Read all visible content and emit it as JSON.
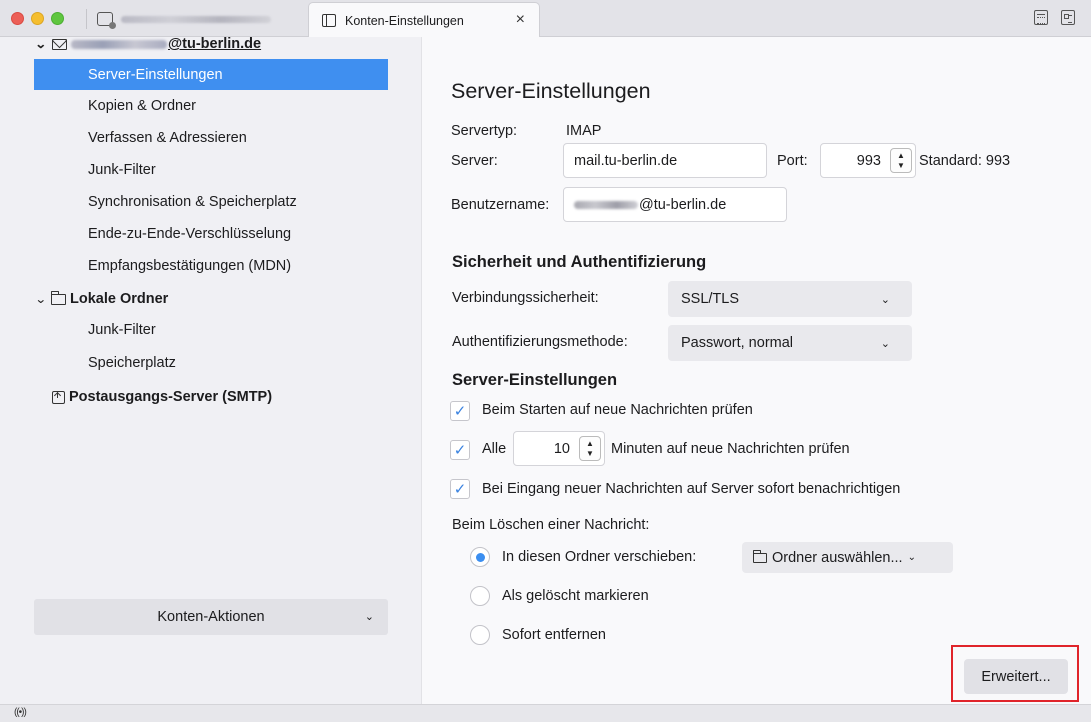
{
  "tabs": {
    "active_title": "Konten-Einstellungen",
    "close_glyph": "×"
  },
  "sidebar": {
    "account_domain": "@tu-berlin.de",
    "account_items": [
      {
        "label": "Server-Einstellungen",
        "selected": true
      },
      {
        "label": "Kopien & Ordner"
      },
      {
        "label": "Verfassen & Adressieren"
      },
      {
        "label": "Junk-Filter"
      },
      {
        "label": "Synchronisation & Speicherplatz"
      },
      {
        "label": "Ende-zu-Ende-Verschlüsselung"
      },
      {
        "label": "Empfangsbestätigungen (MDN)"
      }
    ],
    "local_folders_label": "Lokale Ordner",
    "local_items": [
      {
        "label": "Junk-Filter"
      },
      {
        "label": "Speicherplatz"
      }
    ],
    "smtp_label": "Postausgangs-Server (SMTP)",
    "account_actions_label": "Konten-Aktionen"
  },
  "main": {
    "title": "Server-Einstellungen",
    "servertype_label": "Servertyp:",
    "servertype_value": "IMAP",
    "server_label": "Server:",
    "server_value": "mail.tu-berlin.de",
    "port_label": "Port:",
    "port_value": "993",
    "standard_label": "Standard: 993",
    "username_label": "Benutzername:",
    "username_domain": "@tu-berlin.de",
    "security_heading": "Sicherheit und Authentifizierung",
    "connection_security_label": "Verbindungssicherheit:",
    "connection_security_value": "SSL/TLS",
    "auth_method_label": "Authentifizierungsmethode:",
    "auth_method_value": "Passwort, normal",
    "server_settings_heading": "Server-Einstellungen",
    "check_on_start_label": "Beim Starten auf neue Nachrichten prüfen",
    "check_on_start_checked": true,
    "check_every_label": "Alle",
    "check_every_value": "10",
    "check_every_suffix": "Minuten auf neue Nachrichten prüfen",
    "check_every_checked": true,
    "notify_label": "Bei Eingang neuer Nachrichten auf Server sofort benachrichtigen",
    "notify_checked": true,
    "delete_heading": "Beim Löschen einer Nachricht:",
    "delete_options": [
      {
        "label": "In diesen Ordner verschieben:",
        "selected": true
      },
      {
        "label": "Als gelöscht markieren",
        "selected": false
      },
      {
        "label": "Sofort entfernen",
        "selected": false
      }
    ],
    "folder_select_label": "Ordner auswählen...",
    "advanced_button": "Erweitert..."
  },
  "colors": {
    "selection": "#3f8ff0",
    "highlight_frame": "#e0242a"
  }
}
